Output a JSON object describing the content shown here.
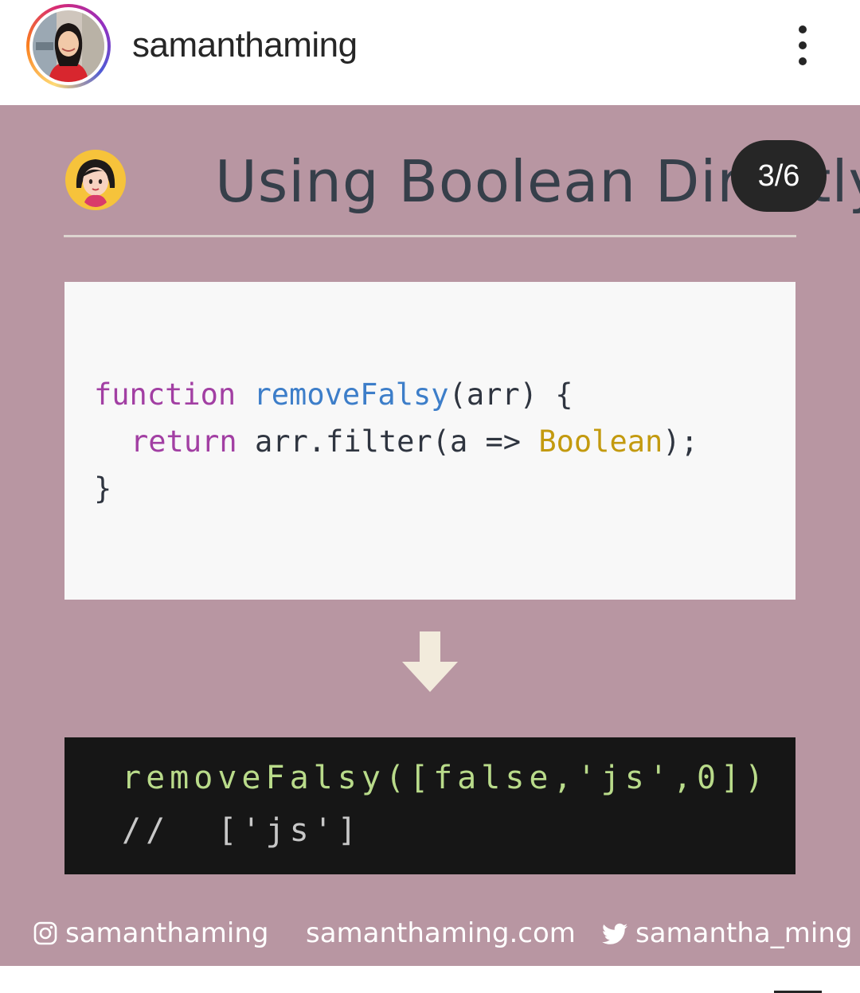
{
  "header": {
    "username": "samanthaming"
  },
  "slide": {
    "title": "Using Boolean Directly",
    "counter": "3/6",
    "code": {
      "line1": {
        "kw": "function",
        "fn": "removeFalsy",
        "rest": "(arr) {"
      },
      "line2": {
        "kw": "return",
        "pre": "arr.filter(a => ",
        "builtin": "Boolean",
        "post": ");"
      },
      "line3": "}"
    },
    "output": {
      "call": "removeFalsy([false,'js',0])",
      "comment": "//  ['js']"
    },
    "footer": {
      "instagram": "samanthaming",
      "website": "samanthaming.com",
      "twitter": "samantha_ming"
    }
  },
  "colors": {
    "slide_background": "#b896a2",
    "keyword": "#a23fa3",
    "function_name": "#3d7ec9",
    "builtin": "#c39a0f",
    "output_text": "#b9db8a"
  },
  "icons": [
    "more-vertical-icon",
    "instagram-icon",
    "twitter-icon",
    "arrow-down-icon",
    "girl-emoji-icon"
  ]
}
